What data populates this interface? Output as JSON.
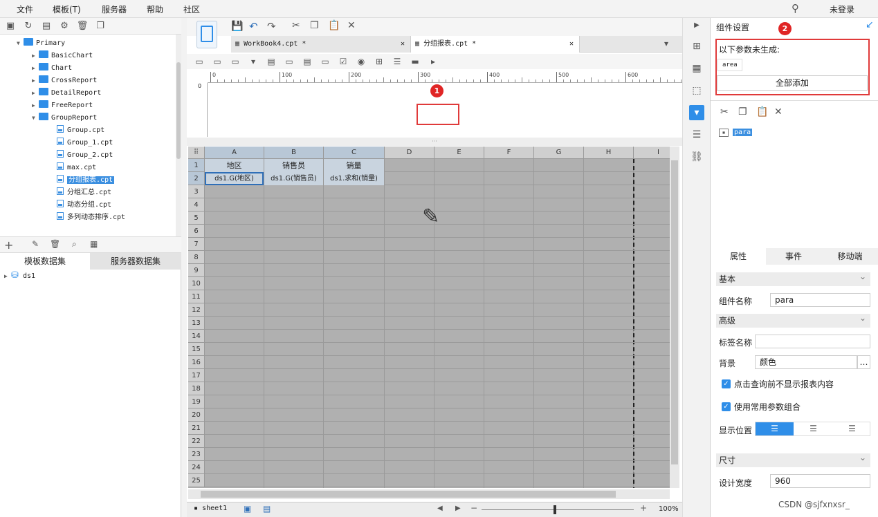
{
  "menu": {
    "file": "文件",
    "template": "模板(T)",
    "server": "服务器",
    "help": "帮助",
    "community": "社区",
    "login": "未登录"
  },
  "tree": {
    "items": [
      {
        "label": "Primary",
        "type": "folder",
        "open": true
      },
      {
        "label": "BasicChart",
        "type": "folder"
      },
      {
        "label": "Chart",
        "type": "folder"
      },
      {
        "label": "CrossReport",
        "type": "folder"
      },
      {
        "label": "DetailReport",
        "type": "folder"
      },
      {
        "label": "FreeReport",
        "type": "folder"
      },
      {
        "label": "GroupReport",
        "type": "folder",
        "open": true
      },
      {
        "label": "Group.cpt",
        "type": "file"
      },
      {
        "label": "Group_1.cpt",
        "type": "file"
      },
      {
        "label": "Group_2.cpt",
        "type": "file"
      },
      {
        "label": "max.cpt",
        "type": "file"
      },
      {
        "label": "分组报表.cpt",
        "type": "file",
        "selected": true
      },
      {
        "label": "分组汇总.cpt",
        "type": "file"
      },
      {
        "label": "动态分组.cpt",
        "type": "file"
      },
      {
        "label": "多列动态排序.cpt",
        "type": "file"
      }
    ]
  },
  "datasets": {
    "tab_template": "模板数据集",
    "tab_server": "服务器数据集",
    "item": "ds1"
  },
  "filetabs": [
    {
      "label": "WorkBook4.cpt *"
    },
    {
      "label": "分组报表.cpt *"
    }
  ],
  "ruler": [
    "0",
    "100",
    "200",
    "300",
    "400",
    "500",
    "600"
  ],
  "badges": {
    "one": "1",
    "two": "2"
  },
  "grid": {
    "columns": [
      "A",
      "B",
      "C",
      "D",
      "E",
      "F",
      "G",
      "H",
      "I"
    ],
    "rows": [
      "1",
      "2",
      "3",
      "4",
      "5",
      "6",
      "7",
      "8",
      "9",
      "10",
      "11",
      "12",
      "13",
      "14",
      "15",
      "16",
      "17",
      "18",
      "19",
      "20",
      "21",
      "22",
      "23",
      "24",
      "25"
    ],
    "r1": [
      "地区",
      "销售员",
      "销量"
    ],
    "r2": [
      "ds1.G(地区)",
      "ds1.G(销售员)",
      "ds1.求和(销量)"
    ]
  },
  "sheetbar": {
    "sheet": "sheet1",
    "zoom": "100%"
  },
  "panel": {
    "title": "组件设置",
    "notice": "以下参数未生成:",
    "param_chip": "area",
    "add_all": "全部添加",
    "widget": "para",
    "tabs": [
      "属性",
      "事件",
      "移动端"
    ],
    "basic": "基本",
    "name_label": "组件名称",
    "name_value": "para",
    "advanced": "高级",
    "tag_label": "标签名称",
    "tag_value": "",
    "bg_label": "背景",
    "bg_value": "颜色",
    "chk1": "点击查询前不显示报表内容",
    "chk2": "使用常用参数组合",
    "pos_label": "显示位置",
    "size": "尺寸",
    "width_label": "设计宽度",
    "width_value": "960"
  },
  "watermark": "CSDN @sjfxnxsr_",
  "colors": {
    "accent": "#2f8ee8",
    "highlight": "#e03a3a",
    "grid_bg": "#b0b0b0"
  }
}
